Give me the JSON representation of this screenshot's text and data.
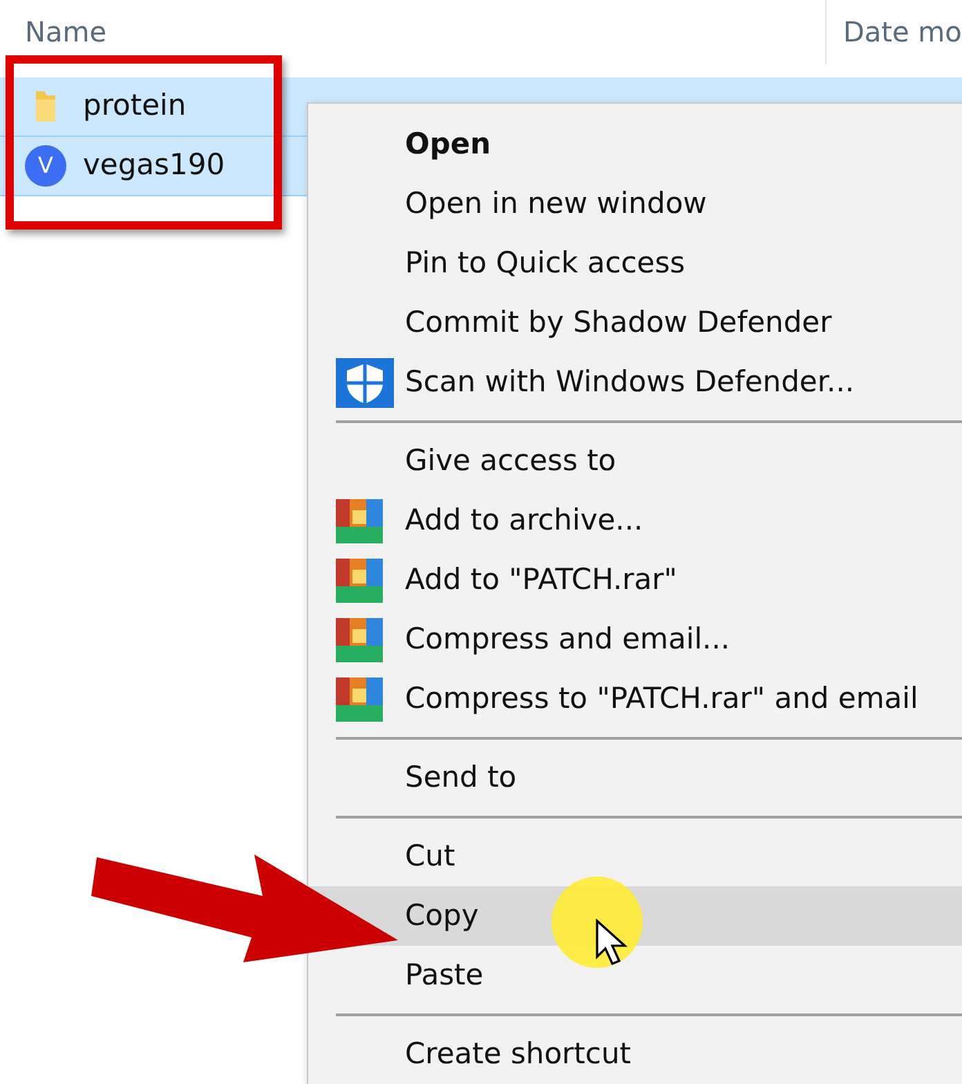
{
  "columns": [
    {
      "label": "Name"
    },
    {
      "label": "Date mo"
    }
  ],
  "files": [
    {
      "name": "protein",
      "kind": "folder",
      "selected": true
    },
    {
      "name": "vegas190",
      "kind": "app",
      "icon_text": "V",
      "selected": true
    }
  ],
  "context_menu": [
    {
      "kind": "item",
      "label": "Open",
      "bold": true,
      "selected": false
    },
    {
      "kind": "item",
      "label": "Open in new window",
      "selected": false
    },
    {
      "kind": "item",
      "label": "Pin to Quick access",
      "selected": false
    },
    {
      "kind": "item",
      "label": "Commit by Shadow Defender",
      "selected": false
    },
    {
      "kind": "shield_item",
      "label": "Scan with Windows Defender...",
      "selected": false
    },
    {
      "kind": "separator"
    },
    {
      "kind": "item",
      "label": "Give access to",
      "selected": false
    },
    {
      "kind": "archive_item",
      "label": "Add to archive...",
      "selected": false
    },
    {
      "kind": "archive_item",
      "label": "Add to \"PATCH.rar\"",
      "selected": false
    },
    {
      "kind": "archive_item",
      "label": "Compress and email...",
      "selected": false
    },
    {
      "kind": "archive_item",
      "label": "Compress to \"PATCH.rar\" and email",
      "selected": false
    },
    {
      "kind": "separator"
    },
    {
      "kind": "item",
      "label": "Send to",
      "selected": false
    },
    {
      "kind": "separator"
    },
    {
      "kind": "item",
      "label": "Cut",
      "selected": false
    },
    {
      "kind": "item",
      "label": "Copy",
      "selected": true
    },
    {
      "kind": "item",
      "label": "Paste",
      "selected": false
    },
    {
      "kind": "separator"
    },
    {
      "kind": "item",
      "label": "Create shortcut",
      "selected": false
    }
  ]
}
